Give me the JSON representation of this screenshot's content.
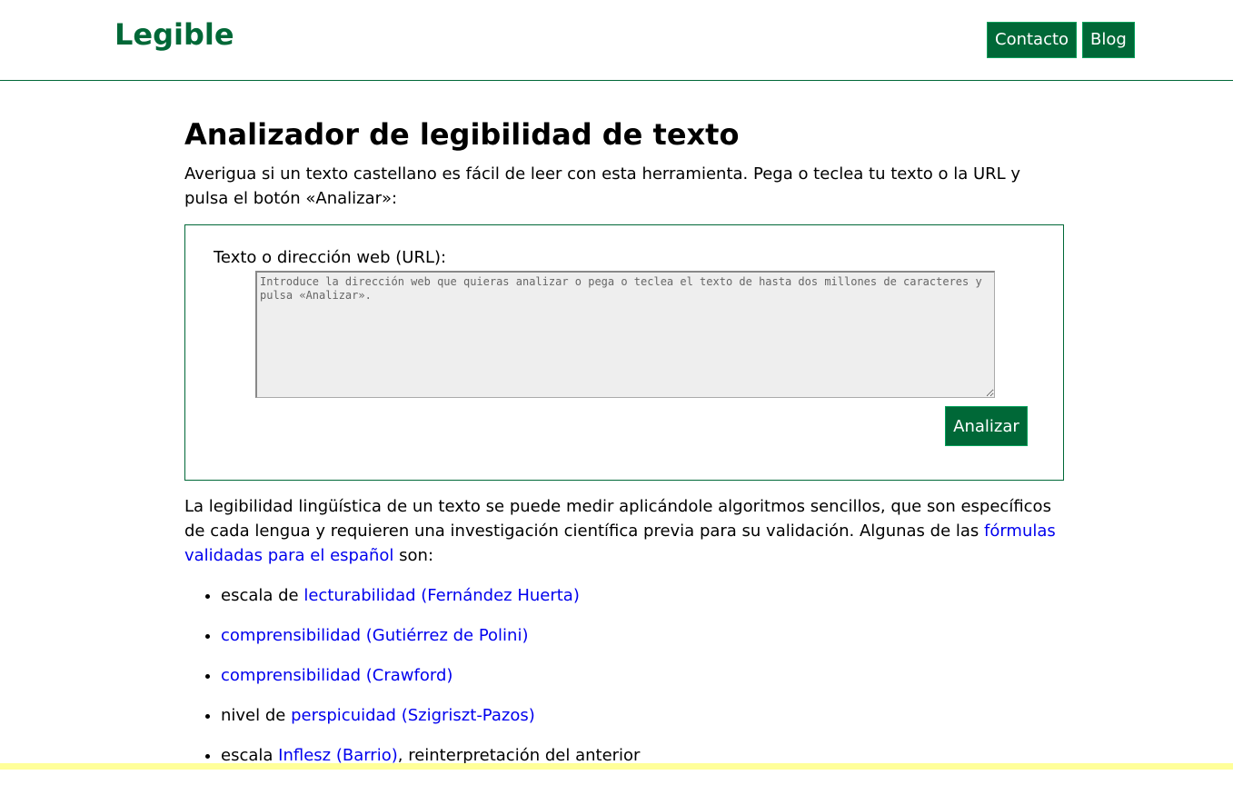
{
  "header": {
    "logo": "Legible",
    "nav": [
      {
        "label": "Contacto"
      },
      {
        "label": "Blog"
      }
    ]
  },
  "main": {
    "title": "Analizador de legibilidad de texto",
    "intro": "Averigua si un texto castellano es fácil de leer con esta herramienta. Pega o teclea tu texto o la URL y pulsa el botón «Analizar»:",
    "form": {
      "label": "Texto o dirección web (URL):",
      "placeholder": "Introduce la dirección web que quieras analizar o pega o teclea el texto de hasta dos millones de caracteres y pulsa «Analizar».",
      "value": "",
      "submit_label": "Analizar"
    },
    "explanation": {
      "text": "La legibilidad lingüística de un texto se puede medir aplicándole algoritmos sencillos, que son específicos de cada lengua y requieren una investigación científica previa para su validación. Algunas de las ",
      "link": "fórmulas validadas para el español",
      "suffix": " son:"
    },
    "formulas": [
      {
        "prefix": "escala de ",
        "link": "lecturabilidad (Fernández Huerta)",
        "suffix": ""
      },
      {
        "prefix": "",
        "link": "comprensibilidad (Gutiérrez de Polini)",
        "suffix": ""
      },
      {
        "prefix": "",
        "link": "comprensibilidad (Crawford)",
        "suffix": ""
      },
      {
        "prefix": "nivel de ",
        "link": "perspicuidad (Szigriszt-Pazos)",
        "suffix": ""
      },
      {
        "prefix": "escala ",
        "link": "Inflesz (Barrio)",
        "suffix": ", reinterpretación del anterior"
      }
    ]
  },
  "colors": {
    "brand": "#006837",
    "link": "#0000ee",
    "bottom_bar": "#ffff99"
  }
}
